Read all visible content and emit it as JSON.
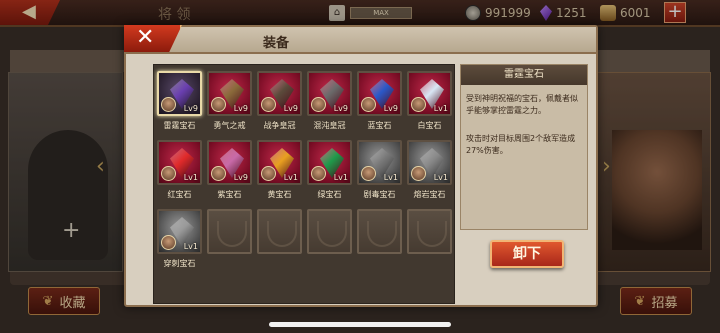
{
  "top_bar": {
    "back_icon": "arrow-left-icon",
    "title": "将 领",
    "max_label": "MAX",
    "silver": "991999",
    "gems": "1251",
    "grain": "6001",
    "plus_label": "+"
  },
  "background": {
    "favorites_label": "收藏",
    "recruit_label": "招募",
    "add_label": "+"
  },
  "modal": {
    "title": "装备",
    "close_label": "✕",
    "unequip_label": "卸下",
    "detail": {
      "name": "雷霆宝石",
      "text1": "受到神明祝福的宝石，佩戴者似乎能够掌控雷霆之力。",
      "text2": "攻击时对目标周围2个敌军造成27%伤害。"
    },
    "items": [
      {
        "name": "雷霆宝石",
        "level": "Lv9",
        "style": "dark",
        "gem_color": "#6a3fb0"
      },
      {
        "name": "勇气之戒",
        "level": "Lv9",
        "style": "red",
        "gem_color": "#8a6a3a"
      },
      {
        "name": "战争皇冠",
        "level": "Lv9",
        "style": "red",
        "gem_color": "#5a4a3a"
      },
      {
        "name": "混沌皇冠",
        "level": "Lv9",
        "style": "red",
        "gem_color": "#6a6a6a"
      },
      {
        "name": "蓝宝石",
        "level": "Lv9",
        "style": "red",
        "gem_color": "#2a58c8"
      },
      {
        "name": "白宝石",
        "level": "Lv1",
        "style": "red",
        "gem_color": "#d8e6f4"
      },
      {
        "name": "红宝石",
        "level": "Lv1",
        "style": "red",
        "gem_color": "#e02a2a"
      },
      {
        "name": "紫宝石",
        "level": "Lv9",
        "style": "red",
        "gem_color": "#c86aa8"
      },
      {
        "name": "黄宝石",
        "level": "Lv1",
        "style": "red",
        "gem_color": "#e8a020"
      },
      {
        "name": "绿宝石",
        "level": "Lv1",
        "style": "red",
        "gem_color": "#1e9a4a"
      },
      {
        "name": "剧毒宝石",
        "level": "Lv1",
        "style": "gray",
        "gem_color": "#7a7a7a"
      },
      {
        "name": "熔岩宝石",
        "level": "Lv1",
        "style": "gray",
        "gem_color": "#8a8a8a"
      },
      {
        "name": "穿刺宝石",
        "level": "Lv1",
        "style": "gray",
        "gem_color": "#9a9a9a"
      }
    ]
  }
}
